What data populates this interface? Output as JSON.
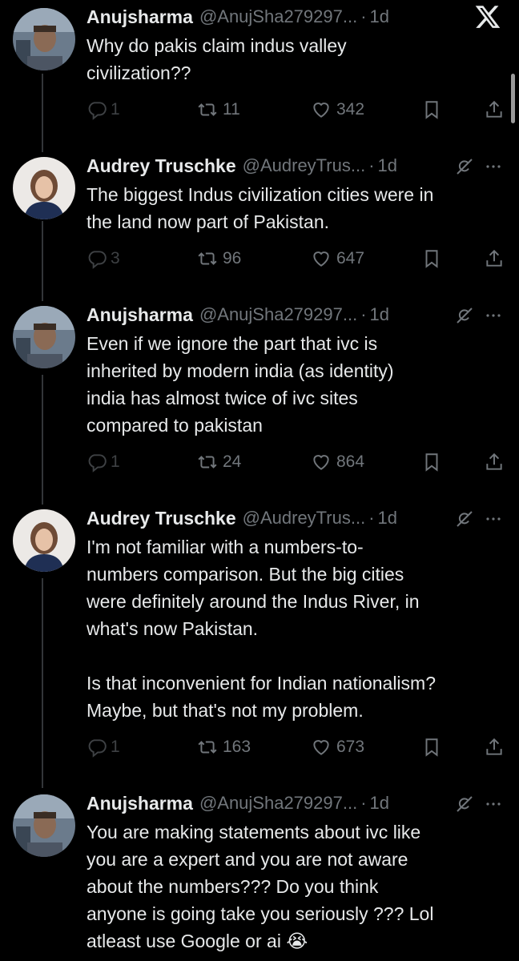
{
  "app": {
    "logo_icon": "x-logo-icon"
  },
  "tweets": [
    {
      "name": "Anujsharma",
      "handle": "@AnujSha279297...",
      "separator": "·",
      "time": "1d",
      "text": "Why do pakis claim indus valley\ncivilization??",
      "replies": "1",
      "retweets": "11",
      "likes": "342",
      "avatar": "man-photo"
    },
    {
      "name": "Audrey Truschke",
      "handle": "@AudreyTrus...",
      "separator": "·",
      "time": "1d",
      "text": "The biggest Indus civilization cities were in\nthe land now part of Pakistan.",
      "replies": "3",
      "retweets": "96",
      "likes": "647",
      "avatar": "woman-photo"
    },
    {
      "name": "Anujsharma",
      "handle": "@AnujSha279297...",
      "separator": "·",
      "time": "1d",
      "text": "Even if we ignore the part that ivc is\ninherited by modern india (as identity)\nindia has almost twice of ivc sites\ncompared to pakistan",
      "replies": "1",
      "retweets": "24",
      "likes": "864",
      "avatar": "man-photo"
    },
    {
      "name": "Audrey Truschke",
      "handle": "@AudreyTrus...",
      "separator": "·",
      "time": "1d",
      "text": "I'm not familiar with a numbers-to-\nnumbers comparison. But the big cities\nwere definitely around the Indus River, in\nwhat's now Pakistan.\n\nIs that inconvenient for Indian nationalism?\nMaybe, but that's not my problem.",
      "replies": "1",
      "retweets": "163",
      "likes": "673",
      "avatar": "woman-photo"
    },
    {
      "name": "Anujsharma",
      "handle": "@AnujSha279297...",
      "separator": "·",
      "time": "1d",
      "text": "You are making statements about ivc like\nyou are a expert and you are not aware\nabout the numbers??? Do you think\nanyone is going take you seriously ??? Lol\natleast use Google or ai 😭",
      "avatar": "man-photo"
    }
  ],
  "colors": {
    "background": "#000000",
    "text": "#e7e9ea",
    "muted": "#71767b",
    "divider": "#333639"
  }
}
